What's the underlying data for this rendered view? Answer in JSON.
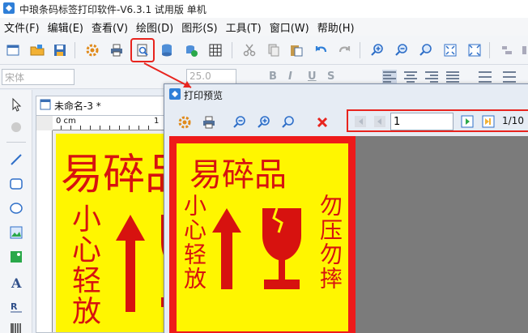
{
  "app": {
    "title": "中琅条码标签打印软件-V6.3.1 试用版 单机"
  },
  "menu": [
    {
      "label": "文件(F)"
    },
    {
      "label": "编辑(E)"
    },
    {
      "label": "查看(V)"
    },
    {
      "label": "绘图(D)"
    },
    {
      "label": "图形(S)"
    },
    {
      "label": "工具(T)"
    },
    {
      "label": "窗口(W)"
    },
    {
      "label": "帮助(H)"
    }
  ],
  "formatbar": {
    "font_name": "宋体",
    "font_size": "25.0"
  },
  "document": {
    "tab_title": "未命名-3 *",
    "ruler_label": "0 cm",
    "ruler_label_1": "1"
  },
  "preview": {
    "title": "打印预览",
    "page_input": "1",
    "page_count": "1/10"
  },
  "label_content": {
    "title": "易碎品",
    "left_text": "小心轻放",
    "right_text": "勿压勿摔"
  },
  "colors": {
    "label_bg": "#fff600",
    "label_red": "#d7120f",
    "frame_red": "#ee1a1a",
    "highlight": "#e8241e"
  }
}
